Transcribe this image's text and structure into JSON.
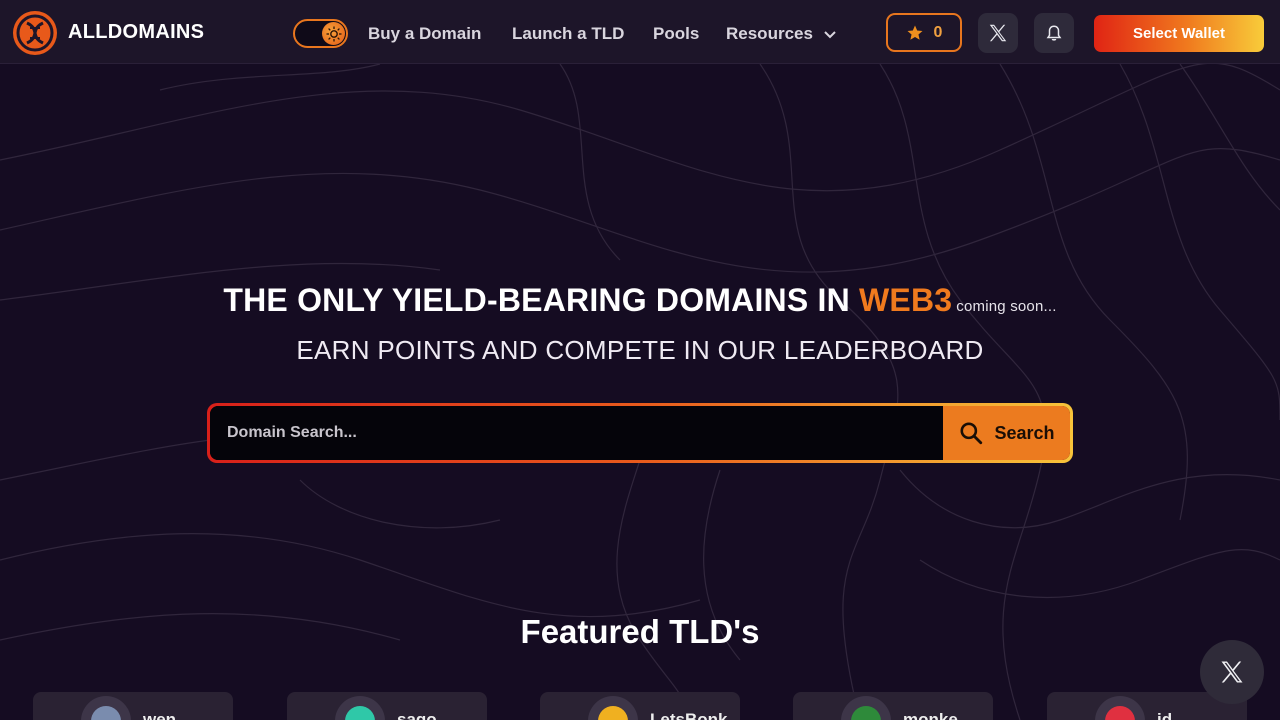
{
  "header": {
    "brand": "ALLDOMAINS",
    "nav": [
      {
        "label": "Buy a Domain"
      },
      {
        "label": "Launch a TLD"
      },
      {
        "label": "Pools"
      },
      {
        "label": "Resources"
      }
    ],
    "points_count": "0",
    "wallet_label": "Select Wallet"
  },
  "hero": {
    "title_main": "THE ONLY YIELD-BEARING DOMAINS IN",
    "title_accent": "WEB3",
    "title_note": "coming soon...",
    "subtitle": "EARN POINTS AND COMPETE IN OUR LEADERBOARD"
  },
  "search": {
    "placeholder": "Domain Search...",
    "button_label": "Search"
  },
  "featured": {
    "title": "Featured TLD's",
    "tlds": [
      {
        "name": "wen",
        "color": "#7a8cae"
      },
      {
        "name": "sago",
        "color": "#2fc8a8"
      },
      {
        "name": "LetsBonk",
        "color": "#f0b020"
      },
      {
        "name": "monke",
        "color": "#2e8a3a"
      },
      {
        "name": "id",
        "color": "#e03040"
      }
    ]
  },
  "colors": {
    "accent": "#f07a1e",
    "background": "#150c22",
    "header": "#1d1529"
  },
  "icons": [
    "brand-logo-icon",
    "sun-icon",
    "chevron-down-icon",
    "star-icon",
    "x-logo-icon",
    "bell-icon",
    "search-icon"
  ]
}
